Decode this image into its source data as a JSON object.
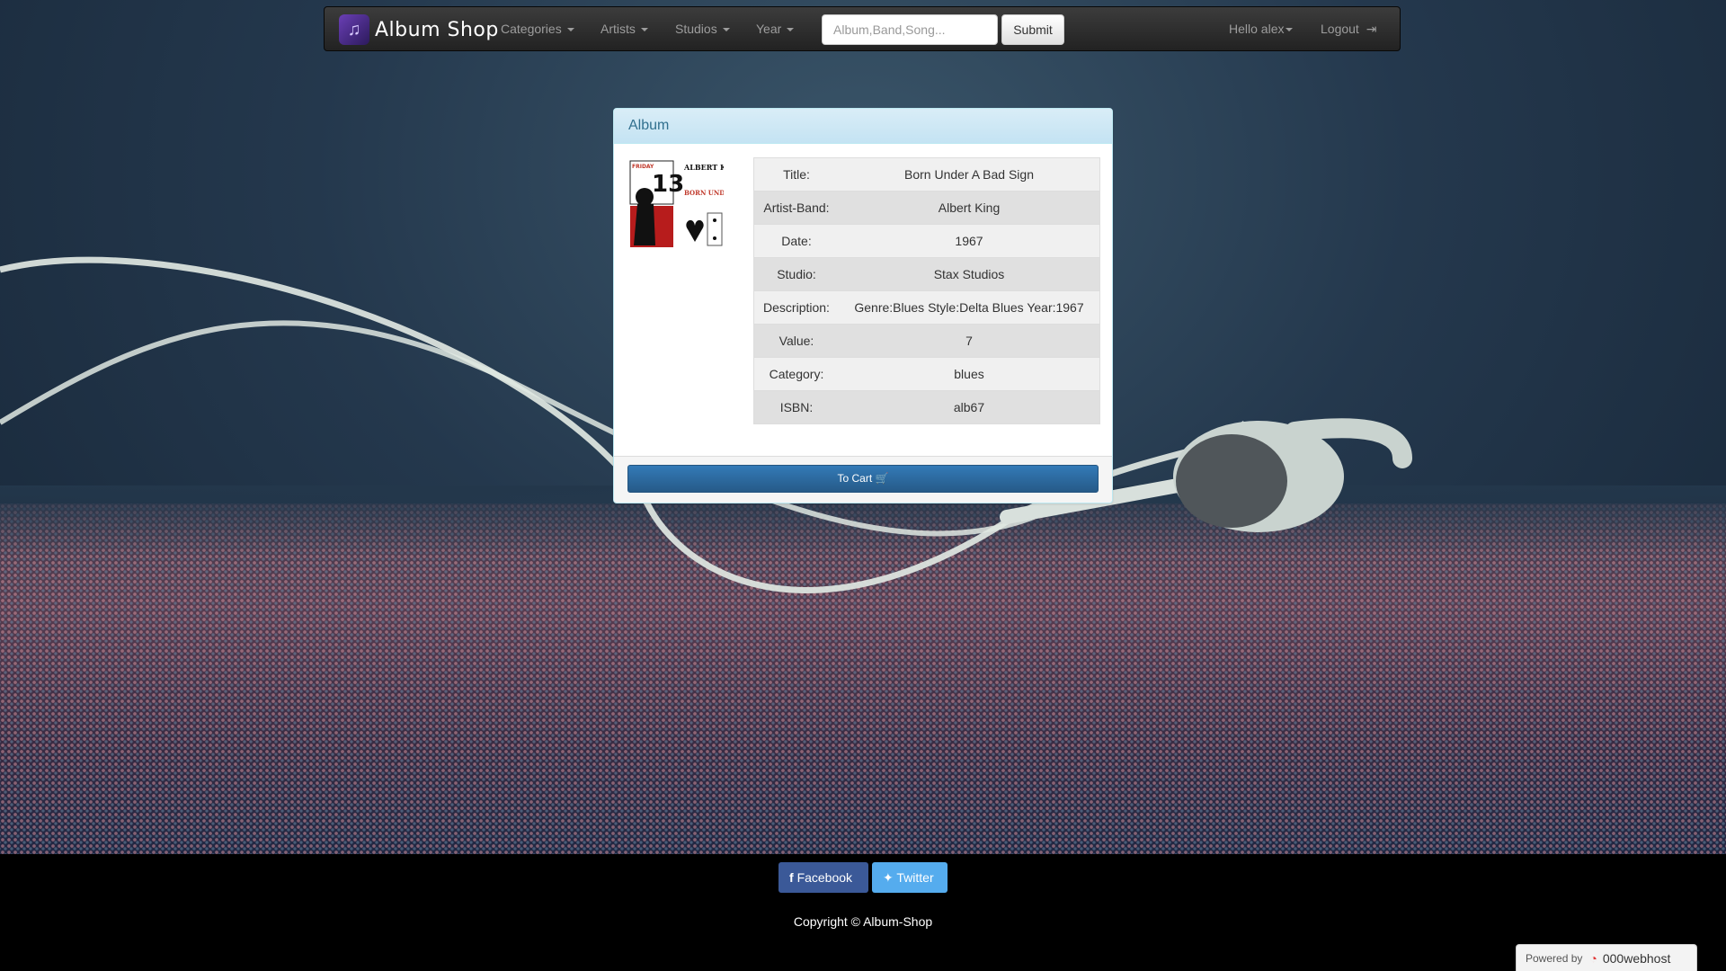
{
  "navbar": {
    "brand": "Album Shop",
    "menu": [
      "Categories",
      "Artists",
      "Studios",
      "Year"
    ],
    "search_placeholder": "Album,Band,Song...",
    "submit_label": "Submit",
    "user_greeting": "Hello alex",
    "logout_label": "Logout"
  },
  "panel": {
    "heading": "Album",
    "cover_text": {
      "day": "FRIDAY",
      "number": "13",
      "artist": "ALBERT KING",
      "title": "BORN UNDER A BAD SIGN"
    },
    "details": [
      {
        "label": "Title:",
        "value": "Born Under A Bad Sign"
      },
      {
        "label": "Artist-Band:",
        "value": "Albert King"
      },
      {
        "label": "Date:",
        "value": "1967"
      },
      {
        "label": "Studio:",
        "value": "Stax Studios"
      },
      {
        "label": "Description:",
        "value": "Genre:Blues Style:Delta Blues Year:1967"
      },
      {
        "label": "Value:",
        "value": "7"
      },
      {
        "label": "Category:",
        "value": "blues"
      },
      {
        "label": "ISBN:",
        "value": "alb67"
      }
    ],
    "cart_label": "To Cart"
  },
  "footer": {
    "facebook_label": "Facebook",
    "twitter_label": "Twitter",
    "copyright": "Copyright © Album-Shop"
  },
  "badge": {
    "powered_label": "Powered by",
    "host": "000webhost"
  },
  "icons": {
    "brand": "music-note-icon",
    "logout": "sign-out-icon",
    "cart": "shopping-cart-icon",
    "facebook": "facebook-icon",
    "twitter": "twitter-icon"
  },
  "colors": {
    "navbar": "#222222",
    "panel_heading": "#d9edf7",
    "panel_heading_text": "#31708f",
    "primary_button": "#337ab7",
    "facebook": "#3b5998",
    "twitter": "#55acee"
  }
}
